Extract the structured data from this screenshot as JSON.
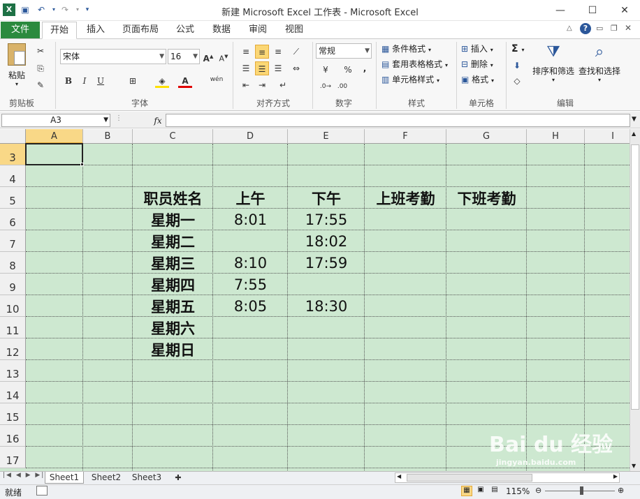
{
  "window": {
    "title": "新建 Microsoft Excel 工作表 - Microsoft Excel"
  },
  "quick_access": {
    "save_icon": "save-icon",
    "undo_icon": "undo-icon",
    "redo_icon": "redo-icon",
    "customize_icon": "chevron-down-icon"
  },
  "ribbon_tabs": [
    {
      "label": "文件",
      "active": false
    },
    {
      "label": "开始",
      "active": true
    },
    {
      "label": "插入",
      "active": false
    },
    {
      "label": "页面布局",
      "active": false
    },
    {
      "label": "公式",
      "active": false
    },
    {
      "label": "数据",
      "active": false
    },
    {
      "label": "审阅",
      "active": false
    },
    {
      "label": "视图",
      "active": false
    }
  ],
  "ribbon": {
    "clipboard": {
      "paste": "粘贴",
      "group": "剪贴板"
    },
    "font": {
      "name": "宋体",
      "size": "16",
      "bold": "B",
      "italic": "I",
      "underline": "U",
      "group": "字体",
      "phonetic": "wén"
    },
    "alignment": {
      "group": "对齐方式"
    },
    "number": {
      "format": "常规",
      "percent": "%",
      "comma": ",",
      "group": "数字"
    },
    "styles": {
      "conditional": "条件格式",
      "table": "套用表格格式",
      "cell": "单元格样式",
      "group": "样式"
    },
    "cells": {
      "insert": "插入",
      "delete": "删除",
      "format": "格式",
      "group": "单元格"
    },
    "editing": {
      "sum": "Σ",
      "sort": "排序和筛选",
      "find": "查找和选择",
      "group": "编辑"
    }
  },
  "formula_bar": {
    "name_box": "A3",
    "fx": "fx",
    "value": ""
  },
  "columns": [
    "A",
    "B",
    "C",
    "D",
    "E",
    "F",
    "G",
    "H",
    "I"
  ],
  "selected_column": "A",
  "rows": [
    "3",
    "4",
    "5",
    "6",
    "7",
    "8",
    "9",
    "10",
    "11",
    "12",
    "13",
    "14",
    "15",
    "16",
    "17"
  ],
  "selected_row": "3",
  "cells": {
    "C5": "职员姓名",
    "D5": "上午",
    "E5": "下午",
    "F5": "上班考勤",
    "G5": "下班考勤",
    "C6": "星期一",
    "D6": "8:01",
    "E6": "17:55",
    "C7": "星期二",
    "D7": "",
    "E7": "18:02",
    "C8": "星期三",
    "D8": "8:10",
    "E8": "17:59",
    "C9": "星期四",
    "D9": "7:55",
    "E9": "",
    "C10": "星期五",
    "D10": "8:05",
    "E10": "18:30",
    "C11": "星期六",
    "C12": "星期日"
  },
  "sheet_tabs": [
    {
      "label": "Sheet1",
      "active": true
    },
    {
      "label": "Sheet2",
      "active": false
    },
    {
      "label": "Sheet3",
      "active": false
    }
  ],
  "status": {
    "ready": "就绪",
    "zoom": "115%"
  },
  "watermark": {
    "brand": "Bai du 经验",
    "url": "jingyan.baidu.com"
  },
  "colors": {
    "file_tab": "#2b8a3e",
    "sheet_bg": "#cde8d0",
    "selection": "#f9d887",
    "accent": "#2b579a"
  }
}
